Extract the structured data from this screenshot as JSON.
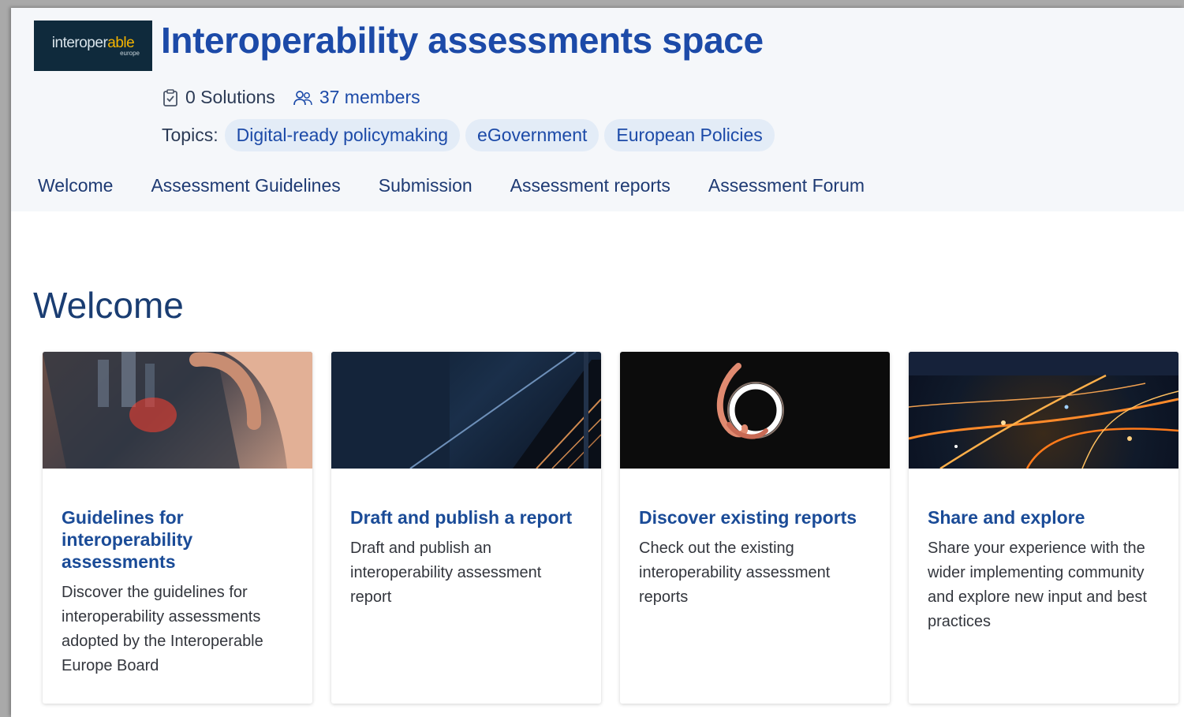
{
  "header": {
    "logo": {
      "text_main": "interoperable",
      "text_sub": "europe"
    },
    "title": "Interoperability assessments space",
    "stats": {
      "solutions": "0 Solutions",
      "members": "37 members"
    },
    "topics_label": "Topics:",
    "topics": [
      "Digital-ready policymaking",
      "eGovernment",
      "European Policies"
    ]
  },
  "nav": {
    "items": [
      "Welcome",
      "Assessment Guidelines",
      "Submission",
      "Assessment reports",
      "Assessment Forum"
    ]
  },
  "main": {
    "heading": "Welcome",
    "cards": [
      {
        "title": "Guidelines for interoperability assessments",
        "text": "Discover the guidelines for interoperability assessments adopted by the Interoperable Europe Board",
        "image": "tablet-hand-photo"
      },
      {
        "title": "Draft and publish a report",
        "text": "Draft and publish an interoperability assessment report",
        "image": "staircase-photo"
      },
      {
        "title": "Discover existing reports",
        "text": "Check out the existing interoperability assessment reports",
        "image": "light-ring-photo"
      },
      {
        "title": "Share and explore",
        "text": "Share your experience with the wider implementing community and explore new input and best practices",
        "image": "city-night-photo"
      }
    ]
  },
  "colors": {
    "title": "#1c4aa8",
    "chip_bg": "#e3ecf7",
    "header_bg": "#f5f7fa",
    "card_title": "#1a4b97",
    "logo_bg": "#0f2a3c",
    "logo_highlight": "#f4b400"
  }
}
